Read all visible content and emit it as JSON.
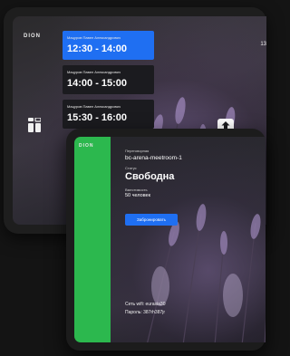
{
  "colors": {
    "accent": "#1f6ff2",
    "status_free": "#2cb84e",
    "background": "#141414"
  },
  "brand": {
    "logo": "DION"
  },
  "schedule": {
    "slots": [
      {
        "organizer": "Мацуров Павел Александрович",
        "time": "12:30 - 14:00",
        "active": true
      },
      {
        "organizer": "Мацуров Павел Александрович",
        "time": "14:00 - 15:00",
        "active": false
      },
      {
        "organizer": "Мацуров Павел Александрович",
        "time": "15:30 - 16:00",
        "active": false
      }
    ],
    "clock_partial": "13",
    "icons": {
      "side": "info-icon",
      "scroll": "arrow-up-icon"
    }
  },
  "room": {
    "title_label": "Переговорная",
    "room_id": "bc-arena-meetroom-1",
    "status_label": "Статус",
    "status_value": "Свободна",
    "capacity_label": "Вместимость",
    "capacity_value": "50 человек",
    "book_button": "Забронировать",
    "wifi_network": "Сеть wifi: eurasia30",
    "wifi_password": "Пароль: 387rh387jr"
  }
}
